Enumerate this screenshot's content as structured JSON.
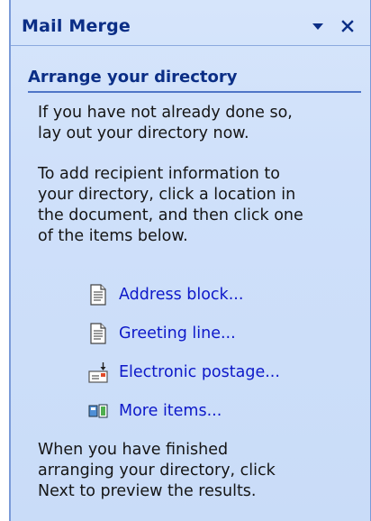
{
  "pane": {
    "title": "Mail Merge",
    "heading": "Arrange your directory",
    "intro_text": "If you have not already done so,\nlay out your directory now.",
    "instructions_text": "To add recipient information to\nyour directory, click a location in\nthe document, and then click one\nof the items below.",
    "footer_text": "When you have finished\narranging your directory, click\nNext to preview the results."
  },
  "items": [
    {
      "label": "Address block...",
      "icon": "document-icon"
    },
    {
      "label": "Greeting line...",
      "icon": "document-icon"
    },
    {
      "label": "Electronic postage...",
      "icon": "postage-icon"
    },
    {
      "label": "More items...",
      "icon": "more-items-icon"
    }
  ],
  "colors": {
    "pane_bg": "#d6e5fb",
    "title_text": "#0b2e86",
    "link_text": "#0d18c9",
    "rule": "#4f75c7"
  }
}
